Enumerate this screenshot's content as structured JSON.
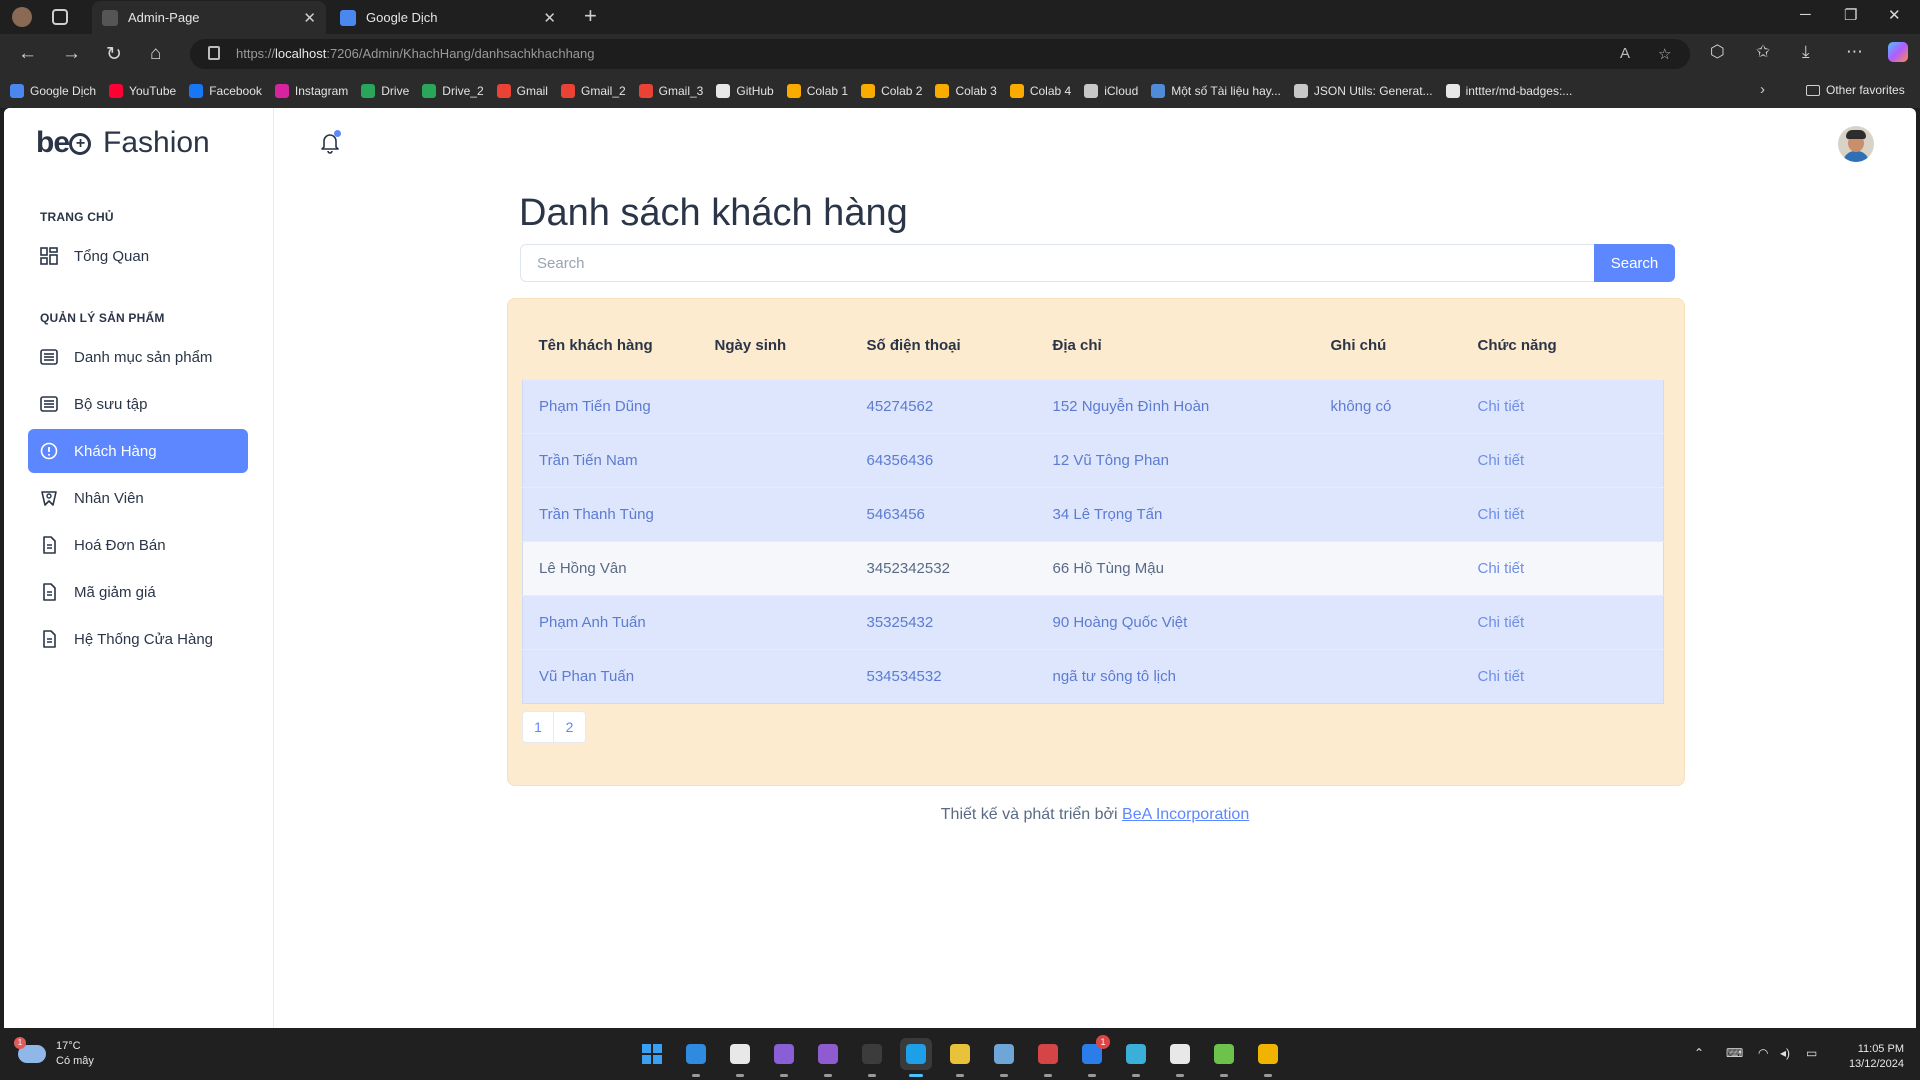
{
  "browser": {
    "tabs": [
      {
        "title": "Admin-Page",
        "active": true
      },
      {
        "title": "Google Dịch",
        "active": false
      }
    ],
    "url_prefix": "https://",
    "url_host": "localhost",
    "url_rest": ":7206/Admin/KhachHang/danhsachkhachhang",
    "bookmarks": [
      "Google Dịch",
      "YouTube",
      "Facebook",
      "Instagram",
      "Drive",
      "Drive_2",
      "Gmail",
      "Gmail_2",
      "Gmail_3",
      "GitHub",
      "Colab 1",
      "Colab 2",
      "Colab 3",
      "Colab 4",
      "iCloud",
      "Một số Tài liệu hay...",
      "JSON Utils: Generat...",
      "inttter/md-badges:..."
    ],
    "bookmark_colors": [
      "#4a88f0",
      "#ff0033",
      "#1877f2",
      "#d6249f",
      "#2aa65a",
      "#2aa65a",
      "#ea4335",
      "#ea4335",
      "#ea4335",
      "#e8e8e8",
      "#f9ab00",
      "#f9ab00",
      "#f9ab00",
      "#f9ab00",
      "#c8c8c8",
      "#4f8bd6",
      "#c8c8c8",
      "#e8e8e8"
    ],
    "other_favorites": "Other favorites"
  },
  "sidebar": {
    "logo_mark": "be",
    "logo_text": "Fashion",
    "sections": [
      {
        "title": "TRANG CHỦ"
      },
      {
        "title": "QUẢN LÝ SẢN PHẨM"
      }
    ],
    "items": [
      {
        "label": "Tổng Quan",
        "icon": "dashboard-icon"
      },
      {
        "label": "Danh mục sản phẩm",
        "icon": "list-icon"
      },
      {
        "label": "Bộ sưu tập",
        "icon": "list-icon"
      },
      {
        "label": "Khách Hàng",
        "icon": "alert-circle-icon",
        "active": true
      },
      {
        "label": "Nhân Viên",
        "icon": "badge-icon"
      },
      {
        "label": "Hoá Đơn Bán",
        "icon": "document-icon"
      },
      {
        "label": "Mã giảm giá",
        "icon": "document-icon"
      },
      {
        "label": "Hệ Thống Cửa Hàng",
        "icon": "document-icon"
      }
    ]
  },
  "header": {
    "notification_icon": "bell-icon",
    "avatar_icon": "user-avatar"
  },
  "main": {
    "title": "Danh sách khách hàng",
    "search_placeholder": "Search",
    "search_button": "Search",
    "columns": [
      "Tên khách hàng",
      "Ngày sinh",
      "Số điện thoại",
      "Địa chỉ",
      "Ghi chú",
      "Chức năng"
    ],
    "rows": [
      {
        "name": "Phạm Tiến Dũng",
        "dob": "",
        "phone": "45274562",
        "address": "152 Nguyễn Đình Hoàn",
        "note": "không có",
        "action": "Chi tiết"
      },
      {
        "name": "Trần Tiến Nam",
        "dob": "",
        "phone": "64356436",
        "address": "12 Vũ Tông Phan",
        "note": "",
        "action": "Chi tiết"
      },
      {
        "name": "Trần Thanh Tùng",
        "dob": "",
        "phone": "5463456",
        "address": "34 Lê Trọng Tấn",
        "note": "",
        "action": "Chi tiết"
      },
      {
        "name": "Lê Hồng Vân",
        "dob": "",
        "phone": "3452342532",
        "address": "66 Hồ Tùng Mậu",
        "note": "",
        "action": "Chi tiết"
      },
      {
        "name": "Phạm Anh Tuấn",
        "dob": "",
        "phone": "35325432",
        "address": "90 Hoàng Quốc Việt",
        "note": "",
        "action": "Chi tiết"
      },
      {
        "name": "Vũ Phan Tuấn",
        "dob": "",
        "phone": "534534532",
        "address": "ngã tư sông tô lịch",
        "note": "",
        "action": "Chi tiết"
      }
    ],
    "pages": [
      "1",
      "2"
    ],
    "footer_text": "Thiết kế và phát triển bởi ",
    "footer_link": "BeA Incorporation"
  },
  "taskbar": {
    "temperature": "17°C",
    "weather": "Có mây",
    "weather_badge": "1",
    "time": "11:05 PM",
    "date": "13/12/2024",
    "app_colors": [
      "#3aa0f3",
      "#2f8be0",
      "#e8e8e8",
      "#8a5fd6",
      "#8e5bd1",
      "#3c3c3c",
      "#1ea0e8",
      "#e8c23a",
      "#6ea6d8",
      "#d64545",
      "#2b7de9",
      "#3ab0d8",
      "#e8e8e8",
      "#6cc24a",
      "#f0b400"
    ],
    "zalo_badge": "1"
  },
  "colors": {
    "accent": "#5d87ff",
    "card_bg": "#fdebd0",
    "row_highlight": "#dde6fd"
  }
}
